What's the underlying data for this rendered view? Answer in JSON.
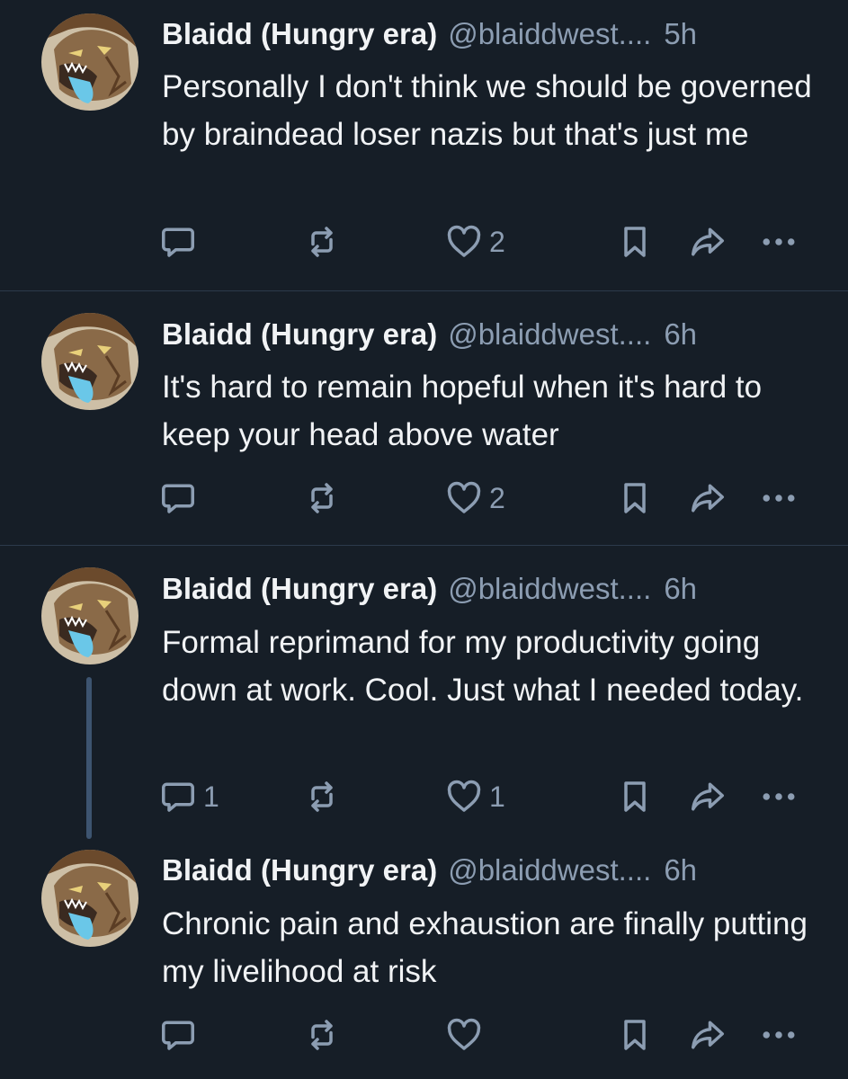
{
  "colors": {
    "background": "#161e27",
    "divider": "#2c3a4b",
    "muted": "#8c9db2",
    "text": "#f1f3f5",
    "thread_line": "#3d5470"
  },
  "posts": [
    {
      "author_name": "Blaidd (Hungry era)",
      "handle": "@blaiddwest....",
      "time": "5h",
      "text": "Personally I don't think we should be governed by braindead loser nazis but that's just me",
      "reply_count": "",
      "repost_count": "",
      "like_count": "2"
    },
    {
      "author_name": "Blaidd (Hungry era)",
      "handle": "@blaiddwest....",
      "time": "6h",
      "text": "It's hard to remain hopeful when it's hard to keep your head above water",
      "reply_count": "",
      "repost_count": "",
      "like_count": "2"
    },
    {
      "author_name": "Blaidd (Hungry era)",
      "handle": "@blaiddwest....",
      "time": "6h",
      "text": "Formal reprimand for my productivity going down at work. Cool. Just what I needed today.",
      "reply_count": "1",
      "repost_count": "",
      "like_count": "1"
    },
    {
      "author_name": "Blaidd (Hungry era)",
      "handle": "@blaiddwest....",
      "time": "6h",
      "text": "Chronic pain and exhaustion are finally putting my livelihood at risk",
      "reply_count": "",
      "repost_count": "",
      "like_count": ""
    }
  ],
  "icons": {
    "reply": "reply-icon",
    "repost": "repost-icon",
    "like": "heart-icon",
    "bookmark": "bookmark-icon",
    "share": "share-icon",
    "more": "more-icon"
  }
}
